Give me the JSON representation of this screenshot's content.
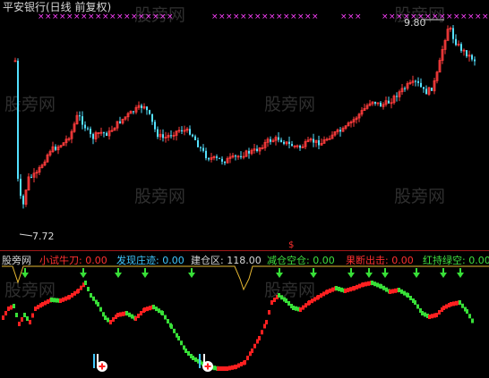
{
  "title": "平安银行(日线 前复权)",
  "watermark": "股旁网",
  "price_labels": {
    "high": "9.80",
    "low": "7.72"
  },
  "lower_panel_name": "股旁网",
  "indicators": [
    {
      "name": "小试牛刀:",
      "value": "0.00",
      "color": "#ff3030"
    },
    {
      "name": "发现庄迹:",
      "value": "0.00",
      "color": "#40c8ff"
    },
    {
      "name": "建仓区:",
      "value": "118.00",
      "color": "#d8d8d8"
    },
    {
      "name": "减仓空仓:",
      "value": "0.00",
      "color": "#40e040"
    },
    {
      "name": "果断出击:",
      "value": "0.00",
      "color": "#ff3030"
    },
    {
      "name": "红持绿空:",
      "value": "0.00",
      "color": "#40e040"
    }
  ],
  "dollar_mark": "$",
  "colors": {
    "up": "#ff3c3c",
    "down": "#54e1ff",
    "green": "#38e038",
    "red": "#ff2020",
    "yellow": "#e6b832",
    "magenta": "#ff40ff"
  },
  "icons": [
    "plus-circle-icon",
    "plus-circle-icon"
  ]
}
